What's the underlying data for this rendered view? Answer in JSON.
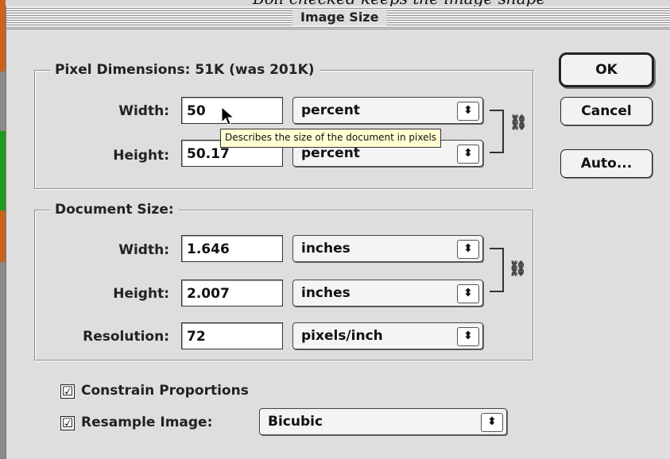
{
  "caption": "Boll checked keeps the image shape",
  "window": {
    "title": "Image Size"
  },
  "pixel_dimensions": {
    "heading": "Pixel Dimensions: 51K (was 201K)",
    "width_label": "Width:",
    "width_value": "50",
    "width_unit": "percent",
    "height_label": "Height:",
    "height_value": "50.17",
    "height_unit": "percent"
  },
  "document_size": {
    "heading": "Document Size:",
    "width_label": "Width:",
    "width_value": "1.646",
    "width_unit": "inches",
    "height_label": "Height:",
    "height_value": "2.007",
    "height_unit": "inches",
    "resolution_label": "Resolution:",
    "resolution_value": "72",
    "resolution_unit": "pixels/inch"
  },
  "tooltip": "Describes the size of the document in pixels",
  "options": {
    "constrain_label": "Constrain Proportions",
    "constrain_checked": true,
    "resample_label": "Resample Image:",
    "resample_checked": true,
    "resample_method": "Bicubic",
    "check_glyph": "☑"
  },
  "buttons": {
    "ok": "OK",
    "cancel": "Cancel",
    "auto": "Auto..."
  },
  "icons": {
    "popup_arrows": "⬍",
    "chain_link": "⛓"
  },
  "colors": {
    "tooltip_bg": "#ffffd2",
    "dialog_bg": "#dedede"
  }
}
